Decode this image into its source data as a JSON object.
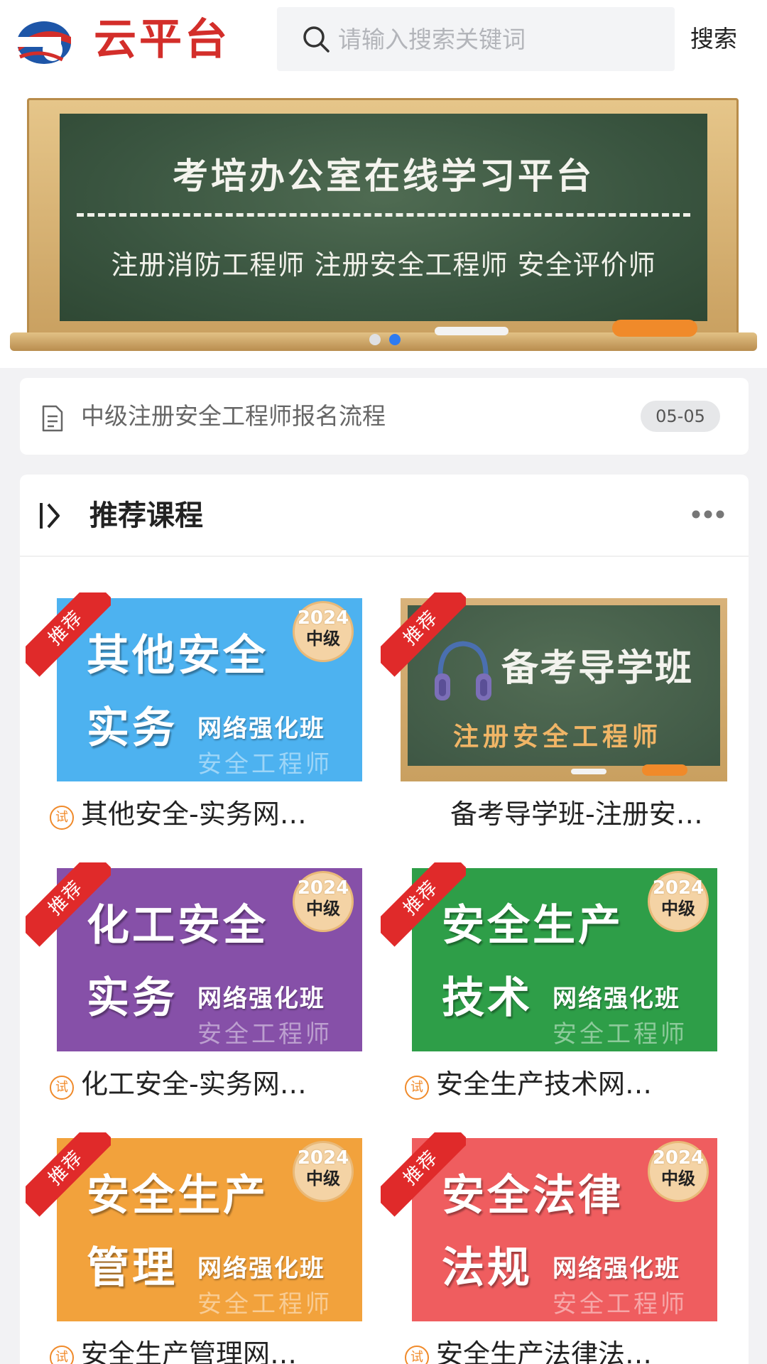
{
  "header": {
    "brand": "云平台",
    "search_placeholder": "请输入搜索关键词",
    "search_button": "搜索"
  },
  "banner": {
    "title": "考培办公室在线学习平台",
    "subtitle": "注册消防工程师   注册安全工程师  安全评价师",
    "slide_count": 2,
    "active_slide": 2
  },
  "notice": {
    "text": "中级注册安全工程师报名流程",
    "date": "05-05"
  },
  "section": {
    "title": "推荐课程"
  },
  "courses": [
    {
      "ribbon": "推荐",
      "line1": "其他安全",
      "line2": "实务",
      "sub": "网络强化班",
      "faint": "安全工程师",
      "year": "2024",
      "level": "中级",
      "title": "其他安全-实务网…",
      "trial": "试",
      "color": "#4db2f0"
    },
    {
      "ribbon": "推荐",
      "line1": "备考导学班",
      "sub": "注册安全工程师",
      "title": "备考导学班-注册安…"
    },
    {
      "ribbon": "推荐",
      "line1": "化工安全",
      "line2": "实务",
      "sub": "网络强化班",
      "faint": "安全工程师",
      "year": "2024",
      "level": "中级",
      "title": "化工安全-实务网…",
      "trial": "试",
      "color": "#8650a8"
    },
    {
      "ribbon": "推荐",
      "line1": "安全生产",
      "line2": "技术",
      "sub": "网络强化班",
      "faint": "安全工程师",
      "year": "2024",
      "level": "中级",
      "title": "安全生产技术网…",
      "trial": "试",
      "color": "#2e9e48"
    },
    {
      "ribbon": "推荐",
      "line1": "安全生产",
      "line2": "管理",
      "sub": "网络强化班",
      "faint": "安全工程师",
      "year": "2024",
      "level": "中级",
      "title": "安全生产管理网…",
      "trial": "试",
      "color": "#f2a23c"
    },
    {
      "ribbon": "推荐",
      "line1": "安全法律",
      "line2": "法规",
      "sub": "网络强化班",
      "faint": "安全工程师",
      "year": "2024",
      "level": "中级",
      "title": "安全生产法律法…",
      "trial": "试",
      "color": "#ef5d5f"
    }
  ]
}
